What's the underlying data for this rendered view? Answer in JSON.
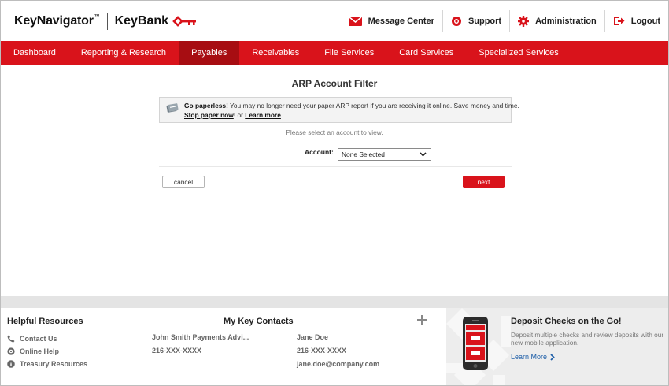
{
  "header": {
    "product_name": "KeyNavigator",
    "product_mark": "™",
    "bank_name": "KeyBank",
    "nav": [
      {
        "label": "Message Center",
        "icon": "envelope-icon"
      },
      {
        "label": "Support",
        "icon": "lifebuoy-icon"
      },
      {
        "label": "Administration",
        "icon": "gear-icon"
      },
      {
        "label": "Logout",
        "icon": "logout-icon"
      }
    ]
  },
  "main_nav": {
    "active": "Payables",
    "tabs": [
      {
        "label": "Dashboard"
      },
      {
        "label": "Reporting & Research"
      },
      {
        "label": "Payables"
      },
      {
        "label": "Receivables"
      },
      {
        "label": "File Services"
      },
      {
        "label": "Card Services"
      },
      {
        "label": "Specialized Services"
      }
    ]
  },
  "page": {
    "title": "ARP Account Filter",
    "notice": {
      "lead": "Go paperless!",
      "text": " You may no longer need your paper ARP report if you are receiving it online. Save money and time.",
      "link1": "Stop paper now",
      "middle": "! or ",
      "link2": "Learn more"
    },
    "prompt": "Please select an account to view.",
    "account_label": "Account:",
    "account_value": "None Selected",
    "cancel_label": "cancel",
    "next_label": "next"
  },
  "footer": {
    "helpful_title": "Helpful Resources",
    "resources": [
      {
        "label": "Contact Us",
        "icon": "phone-icon"
      },
      {
        "label": "Online Help",
        "icon": "lifebuoy-icon"
      },
      {
        "label": "Treasury Resources",
        "icon": "info-icon"
      }
    ],
    "contacts_title": "My Key Contacts",
    "contacts": [
      {
        "name": "John Smith Payments Advi...",
        "phone": "216-XXX-XXXX",
        "email": ""
      },
      {
        "name": "Jane Doe",
        "phone": "216-XXX-XXXX",
        "email": "jane.doe@company.com"
      }
    ],
    "promo": {
      "title": "Deposit Checks on the Go!",
      "text": "Deposit multiple checks and review deposits with our new mobile application.",
      "link": "Learn More"
    }
  },
  "colors": {
    "brand_red": "#d9131b",
    "active_tab": "#a70d12",
    "link_blue": "#1f5fa8"
  }
}
